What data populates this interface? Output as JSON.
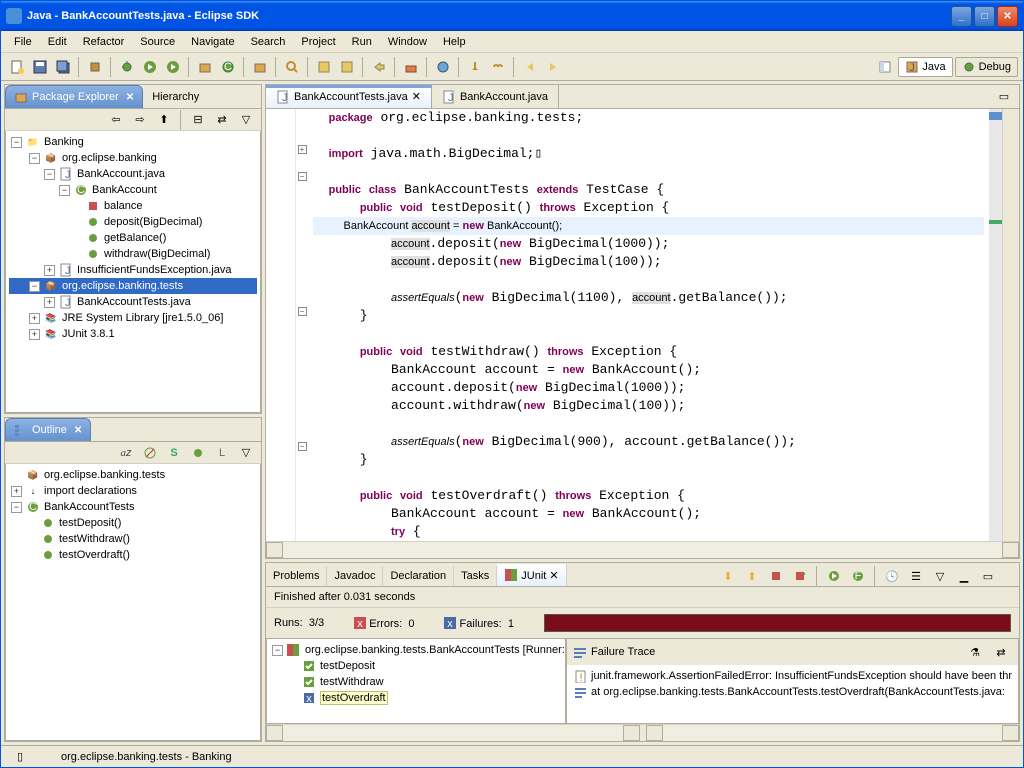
{
  "title": "Java - BankAccountTests.java - Eclipse SDK",
  "menu": [
    "File",
    "Edit",
    "Refactor",
    "Source",
    "Navigate",
    "Search",
    "Project",
    "Run",
    "Window",
    "Help"
  ],
  "perspectives": {
    "java": "Java",
    "debug": "Debug"
  },
  "packageExplorer": {
    "label": "Package Explorer",
    "other_tab": "Hierarchy",
    "project": "Banking",
    "pkg1": "org.eclipse.banking",
    "file1": "BankAccount.java",
    "cls": "BankAccount",
    "fld": "balance",
    "m1": "deposit(BigDecimal)",
    "m2": "getBalance()",
    "m3": "withdraw(BigDecimal)",
    "file2": "InsufficientFundsException.java",
    "pkg2": "org.eclipse.banking.tests",
    "file3": "BankAccountTests.java",
    "lib1": "JRE System Library [jre1.5.0_06]",
    "lib2": "JUnit 3.8.1"
  },
  "outline": {
    "label": "Outline",
    "pkg": "org.eclipse.banking.tests",
    "imp": "import declarations",
    "cls": "BankAccountTests",
    "m1": "testDeposit()",
    "m2": "testWithdraw()",
    "m3": "testOverdraft()"
  },
  "editor": {
    "tab1": "BankAccountTests.java",
    "tab2": "BankAccount.java"
  },
  "junit": {
    "tabs": [
      "Problems",
      "Javadoc",
      "Declaration",
      "Tasks",
      "JUnit"
    ],
    "status": "Finished after 0.031 seconds",
    "runs_lbl": "Runs:",
    "runs": "3/3",
    "err_lbl": "Errors:",
    "err": "0",
    "fail_lbl": "Failures:",
    "fail": "1",
    "suite": "org.eclipse.banking.tests.BankAccountTests [Runner:",
    "t1": "testDeposit",
    "t2": "testWithdraw",
    "t3": "testOverdraft",
    "trace_lbl": "Failure Trace",
    "trace1": "junit.framework.AssertionFailedError: InsufficientFundsException should have been thr",
    "trace2": "at org.eclipse.banking.tests.BankAccountTests.testOverdraft(BankAccountTests.java:"
  },
  "statusbar": "org.eclipse.banking.tests - Banking"
}
